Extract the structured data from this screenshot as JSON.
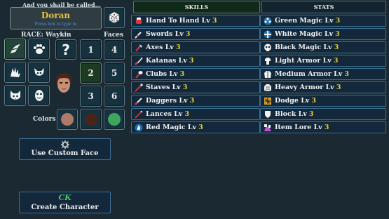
{
  "header": {
    "prompt": "And you shall be called..."
  },
  "name_box": {
    "value": "Doran",
    "hint": "Press box to type in"
  },
  "race": {
    "label": "RACE: Waykin"
  },
  "faces": {
    "label": "Faces",
    "numbers": [
      "1",
      "2",
      "3",
      "4",
      "5",
      "6"
    ],
    "selected": "2"
  },
  "random_button": {
    "glyph": "?"
  },
  "colors": {
    "label": "Colors",
    "swatches": [
      "#b07a6a",
      "#4a2418",
      "#3fa45e"
    ]
  },
  "custom_face_button": {
    "label": "Use Custom Face"
  },
  "create_button": {
    "label": "Create Character",
    "logo": "CK"
  },
  "tables": {
    "skills_title": "SKILLS",
    "stats_title": "STATS",
    "skills": [
      {
        "name": "Hand To Hand Lv",
        "level": "3",
        "icon": "fist-icon"
      },
      {
        "name": "Swords Lv",
        "level": "3",
        "icon": "sword-icon"
      },
      {
        "name": "Axes Lv",
        "level": "3",
        "icon": "axe-icon"
      },
      {
        "name": "Katanas Lv",
        "level": "3",
        "icon": "katana-icon"
      },
      {
        "name": "Clubs Lv",
        "level": "3",
        "icon": "club-icon"
      },
      {
        "name": "Staves Lv",
        "level": "3",
        "icon": "staff-icon"
      },
      {
        "name": "Daggers Lv",
        "level": "3",
        "icon": "dagger-icon"
      },
      {
        "name": "Lances Lv",
        "level": "3",
        "icon": "lance-icon"
      },
      {
        "name": "Red Magic Lv",
        "level": "3",
        "icon": "red-magic-icon"
      }
    ],
    "stats": [
      {
        "name": "Green Magic Lv",
        "level": "3",
        "icon": "green-magic-icon"
      },
      {
        "name": "White Magic Lv",
        "level": "3",
        "icon": "white-magic-icon"
      },
      {
        "name": "Black Magic Lv",
        "level": "3",
        "icon": "black-magic-icon"
      },
      {
        "name": "Light Armor Lv",
        "level": "3",
        "icon": "light-armor-icon"
      },
      {
        "name": "Medium Armor Lv",
        "level": "3",
        "icon": "medium-armor-icon"
      },
      {
        "name": "Heavy Armor Lv",
        "level": "3",
        "icon": "heavy-armor-icon"
      },
      {
        "name": "Dodge Lv",
        "level": "3",
        "icon": "dodge-icon"
      },
      {
        "name": "Block Lv",
        "level": "3",
        "icon": "block-icon"
      },
      {
        "name": "Item Lore Lv",
        "level": "3",
        "icon": "item-lore-icon"
      }
    ]
  }
}
